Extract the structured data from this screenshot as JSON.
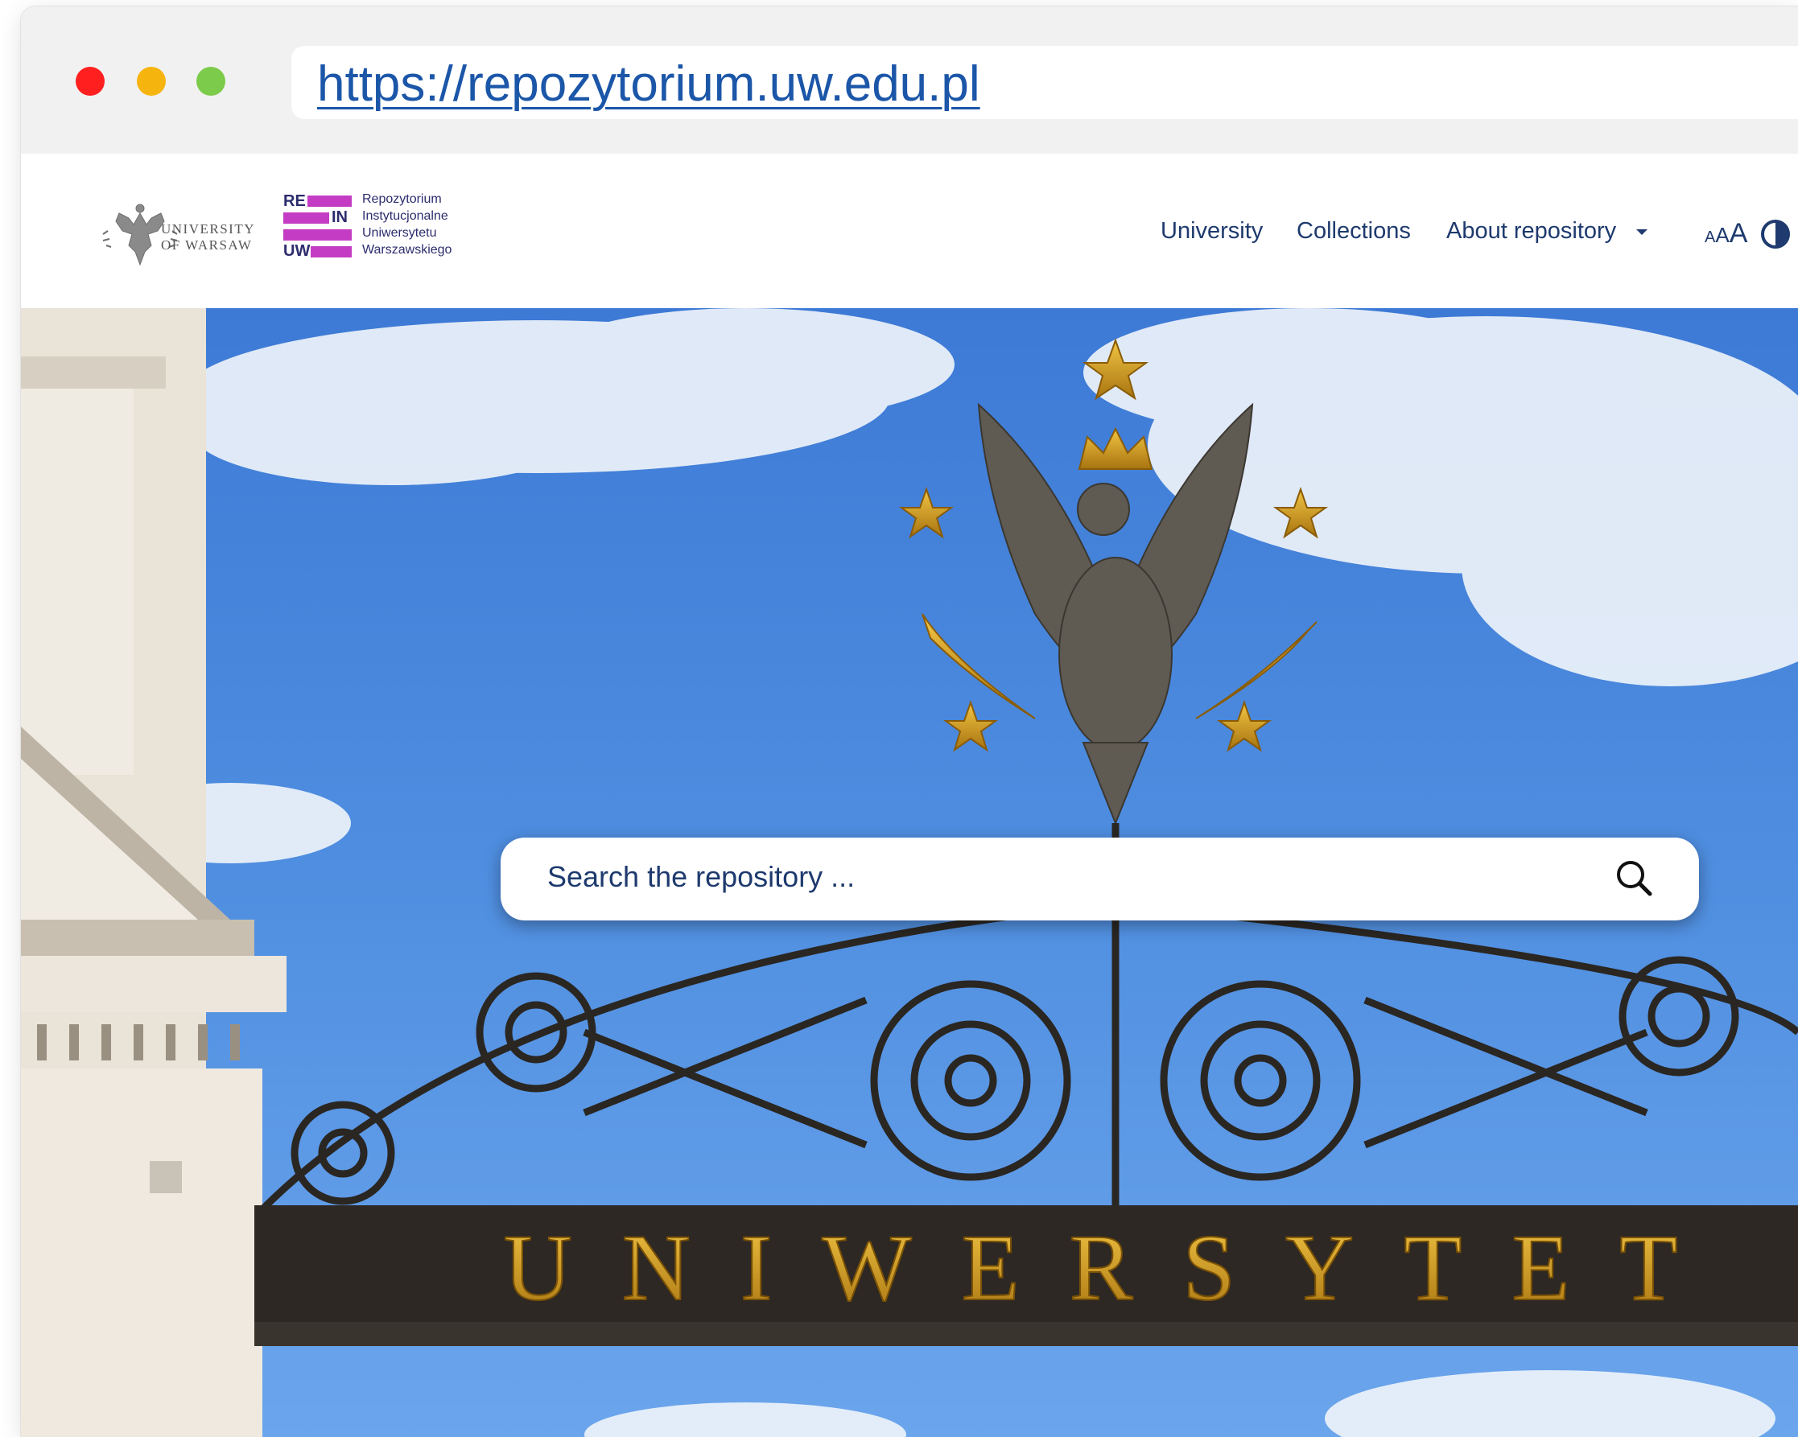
{
  "browser": {
    "url": "https://repozytorium.uw.edu.pl",
    "buttons": {
      "close_color": "#ff1f1f",
      "minimize_color": "#f6b40e",
      "maximize_color": "#7ccb4a"
    }
  },
  "header": {
    "university_logo": {
      "line1": "UNIVERSITY",
      "line2": "OF WARSAW"
    },
    "repository_logo": {
      "letters": [
        "RE",
        "IN",
        "UW"
      ],
      "text_lines": [
        "Repozytorium",
        "Instytucjonalne",
        "Uniwersytetu",
        "Warszawskiego"
      ],
      "bar_color": "#c43cc4"
    },
    "nav": {
      "university": "University",
      "collections": "Collections",
      "about": "About repository"
    },
    "font_size_control": {
      "small": "A",
      "medium": "A",
      "large": "A"
    },
    "contrast_icon": "contrast-icon"
  },
  "hero": {
    "gate_inscription": "UNIWERSYTET",
    "search": {
      "placeholder": "Search the repository ...",
      "icon": "search-icon"
    }
  }
}
